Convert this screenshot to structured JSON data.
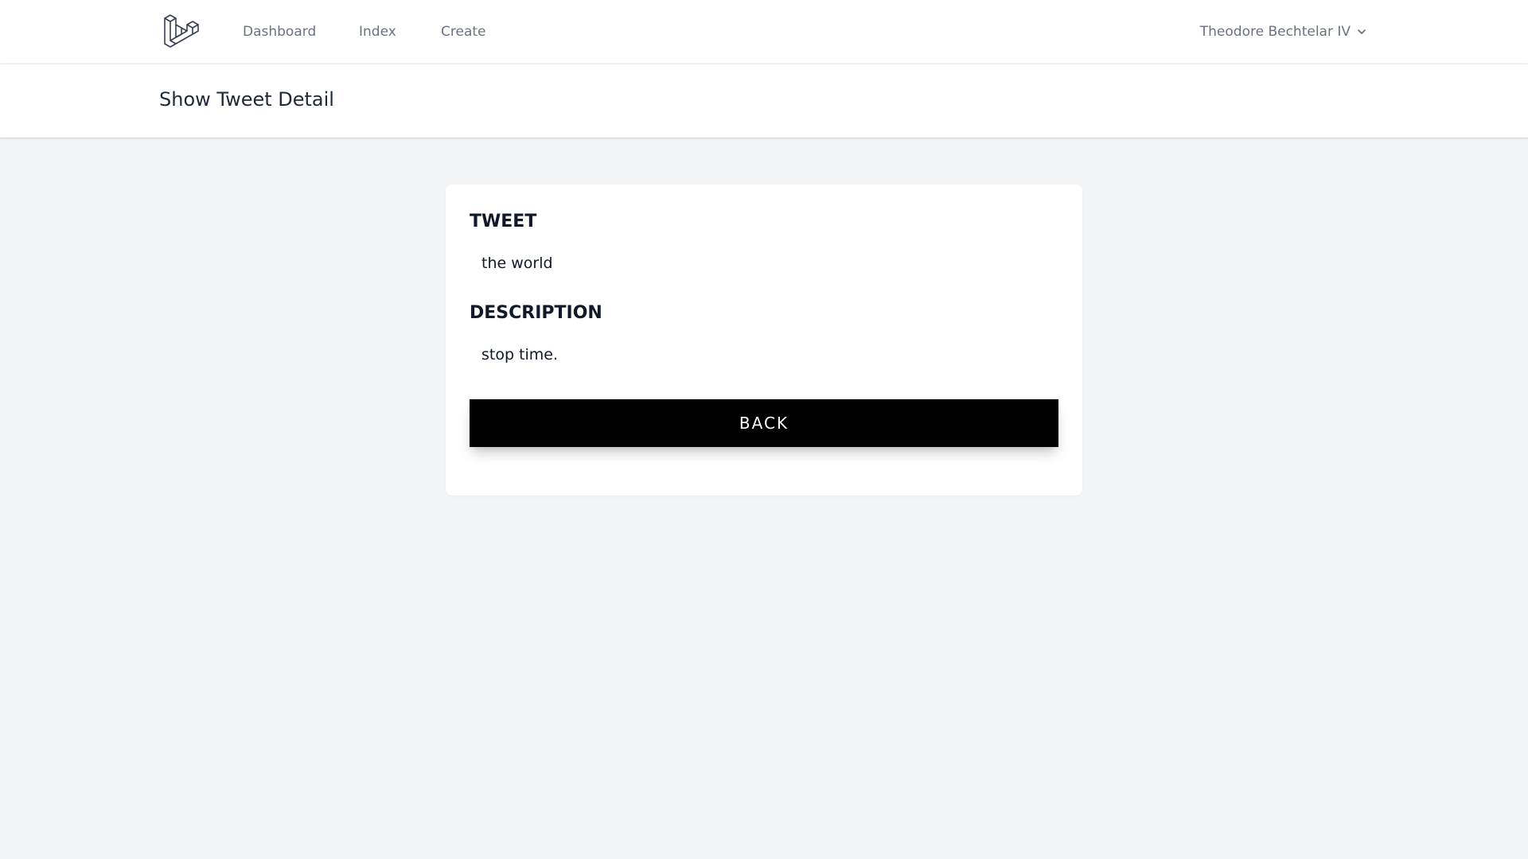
{
  "nav": {
    "logo_icon": "laravel-logo-icon",
    "links": [
      {
        "label": "Dashboard"
      },
      {
        "label": "Index"
      },
      {
        "label": "Create"
      }
    ],
    "user": {
      "name": "Theodore Bechtelar IV",
      "icon": "chevron-down-icon"
    }
  },
  "header": {
    "title": "Show Tweet Detail"
  },
  "card": {
    "tweet_label": "TWEET",
    "tweet_value": "the world",
    "description_label": "DESCRIPTION",
    "description_value": "stop time.",
    "back_label": "BACK"
  },
  "colors": {
    "page_background": "#f3f4f6",
    "surface": "#ffffff",
    "nav_text": "#6b7280",
    "button_background": "#000000",
    "button_text": "#ffffff"
  }
}
